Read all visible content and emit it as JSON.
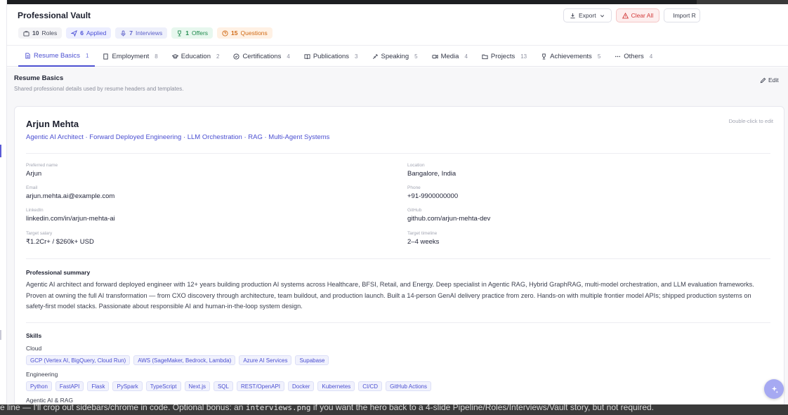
{
  "header": {
    "title": "Professional Vault",
    "stats": [
      {
        "count": "10",
        "label": "Roles"
      },
      {
        "count": "6",
        "label": "Applied"
      },
      {
        "count": "7",
        "label": "Interviews"
      },
      {
        "count": "1",
        "label": "Offers"
      },
      {
        "count": "15",
        "label": "Questions"
      }
    ],
    "actions": {
      "export": "Export",
      "clear_all": "Clear All",
      "import": "Import R"
    }
  },
  "tabs": [
    {
      "label": "Resume Basics",
      "count": "1"
    },
    {
      "label": "Employment",
      "count": "8"
    },
    {
      "label": "Education",
      "count": "2"
    },
    {
      "label": "Certifications",
      "count": "4"
    },
    {
      "label": "Publications",
      "count": "3"
    },
    {
      "label": "Speaking",
      "count": "5"
    },
    {
      "label": "Media",
      "count": "4"
    },
    {
      "label": "Projects",
      "count": "13"
    },
    {
      "label": "Achievements",
      "count": "5"
    },
    {
      "label": "Others",
      "count": "4"
    }
  ],
  "section": {
    "title": "Resume Basics",
    "subtitle": "Shared professional details used by resume headers and templates.",
    "edit_label": "Edit"
  },
  "profile": {
    "name": "Arjun Mehta",
    "hint": "Double-click to edit",
    "headline": "Agentic AI Architect · Forward Deployed Engineering · LLM Orchestration · RAG · Multi-Agent Systems",
    "fields": {
      "preferred_name": {
        "label": "Preferred name",
        "value": "Arjun"
      },
      "location": {
        "label": "Location",
        "value": "Bangalore, India"
      },
      "email": {
        "label": "Email",
        "value": "arjun.mehta.ai@example.com"
      },
      "phone": {
        "label": "Phone",
        "value": "+91-9900000000"
      },
      "linkedin": {
        "label": "LinkedIn",
        "value": "linkedin.com/in/arjun-mehta-ai"
      },
      "github": {
        "label": "GitHub",
        "value": "github.com/arjun-mehta-dev"
      },
      "target_salary": {
        "label": "Target salary",
        "value": "₹1.2Cr+ / $260k+ USD"
      },
      "target_timeline": {
        "label": "Target timeline",
        "value": "2–4 weeks"
      }
    },
    "summary_title": "Professional summary",
    "summary": "Agentic AI architect and forward deployed engineer with 12+ years building production AI systems across Healthcare, BFSI, Retail, and Energy. Deep specialist in Agentic RAG, Hybrid GraphRAG, multi-model orchestration, and LLM evaluation frameworks. Proven at owning the full AI transformation — from CXO discovery through architecture, team buildout, and production launch. Built a 14-person GenAI delivery practice from zero. Hands-on with multiple frontier model APIs; shipped production systems on safety-first model stacks. Passionate about responsible AI and human-in-the-loop system design.",
    "skills_title": "Skills",
    "skills": {
      "cloud": {
        "name": "Cloud",
        "items": [
          "GCP (Vertex AI, BigQuery, Cloud Run)",
          "AWS (SageMaker, Bedrock, Lambda)",
          "Azure AI Services",
          "Supabase"
        ]
      },
      "engineering": {
        "name": "Engineering",
        "items": [
          "Python",
          "FastAPI",
          "Flask",
          "PySpark",
          "TypeScript",
          "Next.js",
          "SQL",
          "REST/OpenAPI",
          "Docker",
          "Kubernetes",
          "CI/CD",
          "GitHub Actions"
        ]
      },
      "agentic": {
        "name": "Agentic AI & RAG"
      }
    }
  },
  "footer": {
    "text_a": "e line — I'll crop out sidebars/chrome in code. Optional bonus: an ",
    "code": "interviews.png",
    "text_b": " if you want the hero back to a 4-slide Pipeline/Roles/Interviews/Vault story, but not required."
  },
  "colors": {
    "accent": "#4b4fd1",
    "danger": "#d23a3a",
    "offers": "#1f8a4d",
    "questions": "#d06a16"
  }
}
